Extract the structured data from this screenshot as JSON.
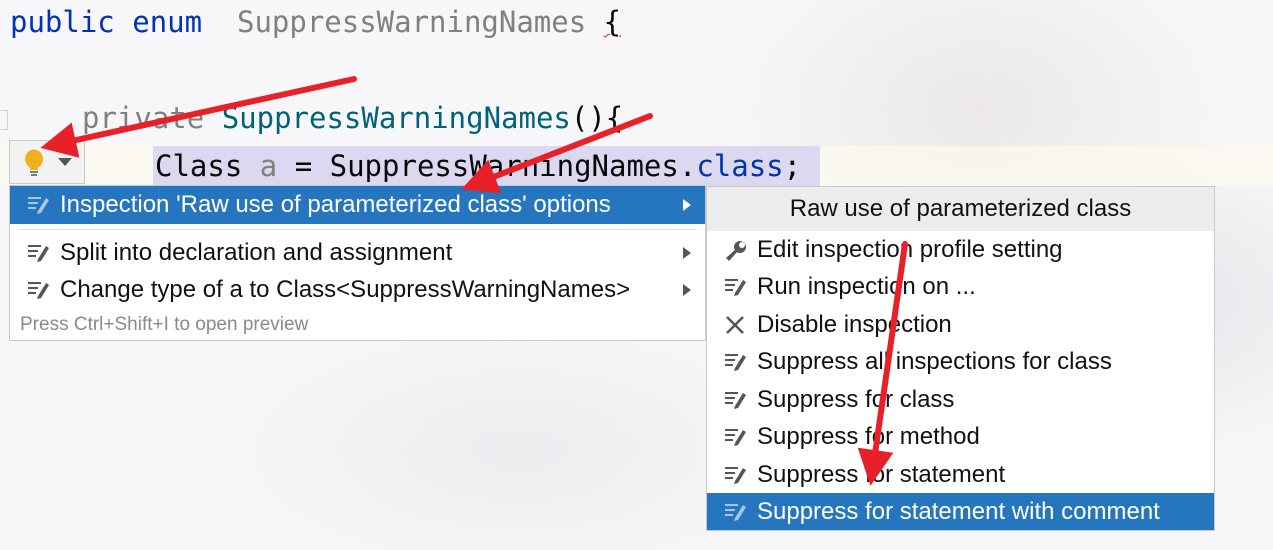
{
  "editor": {
    "line1": {
      "kw_public": "public",
      "kw_enum": "enum",
      "class_name": "SuppressWarningNames",
      "brace": "{"
    },
    "line2": {
      "kw_private": "private",
      "ctor_name": "SuppressWarningNames",
      "paren": "(){"
    },
    "line3": {
      "type": "Class",
      "var": "a",
      "assign": " = ",
      "ref": "SuppressWarningNames",
      "dot": ".",
      "kw_class": "class",
      "semi": ";"
    }
  },
  "intention_menu": {
    "items": [
      {
        "label": "Inspection 'Raw use of parameterized class' options",
        "icon": "quick-fix-icon",
        "has_submenu": true,
        "selected": true
      },
      {
        "label": "Split into declaration and assignment",
        "icon": "quick-fix-icon",
        "has_submenu": true,
        "selected": false
      },
      {
        "label": "Change type of a to Class<SuppressWarningNames>",
        "icon": "quick-fix-icon",
        "has_submenu": true,
        "selected": false
      }
    ],
    "hint": "Press Ctrl+Shift+I to open preview"
  },
  "submenu": {
    "title": "Raw use of parameterized class",
    "items": [
      {
        "label": "Edit inspection profile setting",
        "icon": "wrench-icon",
        "selected": false
      },
      {
        "label": "Run inspection on ...",
        "icon": "quick-fix-icon",
        "selected": false
      },
      {
        "label": "Disable inspection",
        "icon": "close-icon",
        "selected": false
      },
      {
        "label": "Suppress all inspections for class",
        "icon": "quick-fix-icon",
        "selected": false
      },
      {
        "label": "Suppress for class",
        "icon": "quick-fix-icon",
        "selected": false
      },
      {
        "label": "Suppress for method",
        "icon": "quick-fix-icon",
        "selected": false
      },
      {
        "label": "Suppress for statement",
        "icon": "quick-fix-icon",
        "selected": false
      },
      {
        "label": "Suppress for statement with comment",
        "icon": "quick-fix-icon",
        "selected": true
      }
    ]
  },
  "colors": {
    "selection_blue": "#2675bf",
    "annotation_arrow": "#e8202a",
    "bulb": "#f2b01e",
    "keyword": "#0033b3"
  }
}
